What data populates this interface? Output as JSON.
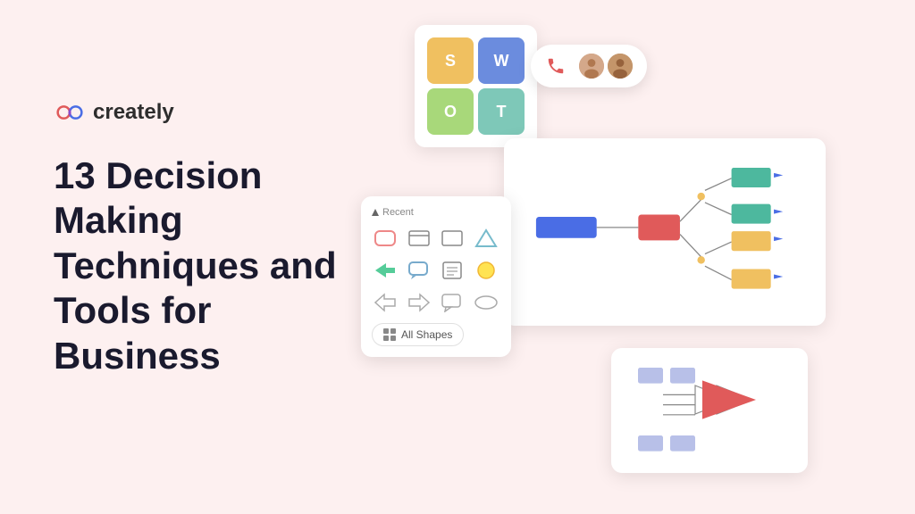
{
  "logo": {
    "text": "creately",
    "icon_name": "creately-logo-icon"
  },
  "headline": {
    "line1": "13 Decision",
    "line2": "Making",
    "line3": "Techniques and",
    "line4": "Tools for",
    "line5": "Business"
  },
  "swot": {
    "s": "S",
    "w": "W",
    "o": "O",
    "t": "T"
  },
  "shapes_panel": {
    "recent_label": "Recent",
    "all_shapes_label": "All Shapes",
    "all_shapes_icon": "grid-icon"
  },
  "colors": {
    "background": "#fdf0f0",
    "accent_blue": "#4a6de5",
    "accent_red": "#e05a5a",
    "accent_green": "#4db89e",
    "accent_yellow": "#f0c060",
    "text_dark": "#1a1a2e"
  }
}
